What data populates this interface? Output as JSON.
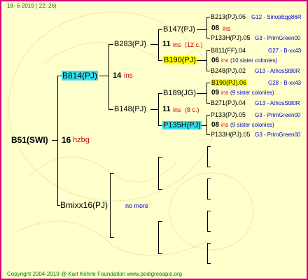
{
  "header": {
    "date": "18-  6-2019 (  22: 26)"
  },
  "footer": {
    "copyright": "Copyright 2004-2019 @ Karl Kehrle Foundation   www.pedigreeapis.org"
  },
  "colors": {
    "border": "#d6007a",
    "background": "#ffffcc",
    "highlight_yellow": "#ffff00",
    "highlight_cyan": "#33e0f0",
    "ins_red": "#cc0000",
    "link_blue": "#0000cc",
    "footer_green": "#008000"
  },
  "root": {
    "id": "B51(SWI)",
    "ins": "16",
    "mark": "hzbg"
  },
  "gen1": {
    "upper": {
      "id": "B814(PJ)",
      "ins": "14",
      "mark": "ins"
    },
    "lower": {
      "id": "Bmixx16(PJ)",
      "note": "no more"
    }
  },
  "gen2": {
    "a": {
      "id": "B283(PJ)",
      "ins": "11",
      "mark": "ins",
      "extra": "(12 c.)"
    },
    "b": {
      "id": "B148(PJ)",
      "ins": "11",
      "mark": "ins",
      "extra": "(8 c.)"
    }
  },
  "gen3": {
    "a1": {
      "id": "B147(PJ)",
      "ins": "08",
      "mark": "ins"
    },
    "a2": {
      "id": "B190(PJ)",
      "ins": "06",
      "mark": "ins",
      "extra": "(10 sister colonies)"
    },
    "b1": {
      "id": "B189(JG)",
      "ins": "09",
      "mark": "ins",
      "extra": "(9 sister colonies)"
    },
    "b2": {
      "id": "P135H(PJ)",
      "ins": "08",
      "mark": "ins",
      "extra": "(9 sister colonies)"
    }
  },
  "gen4": {
    "a1f": {
      "id": "B213(PJ).06",
      "sub": "G12 - SinopEgg86R"
    },
    "a1m": {
      "id": "P133H(PJ).05",
      "sub": "G3 - PrimGreen00"
    },
    "a2f": {
      "id": "B811(FF).04",
      "sub": "G27 - B-xx43"
    },
    "a2m": {
      "id": "B248(PJ).02",
      "sub": "G13 - AthosSt80R"
    },
    "b1f": {
      "id": "B190(PJ).06",
      "sub": "G28 - B-xx43"
    },
    "b1m": {
      "id": "B271(PJ).04",
      "sub": "G13 - AthosSt80R"
    },
    "b2f": {
      "id": "P133(PJ).05",
      "sub": "G3 - PrimGreen00"
    },
    "b2m": {
      "id": "P133H(PJ).05",
      "sub": "G3 - PrimGreen00"
    }
  }
}
